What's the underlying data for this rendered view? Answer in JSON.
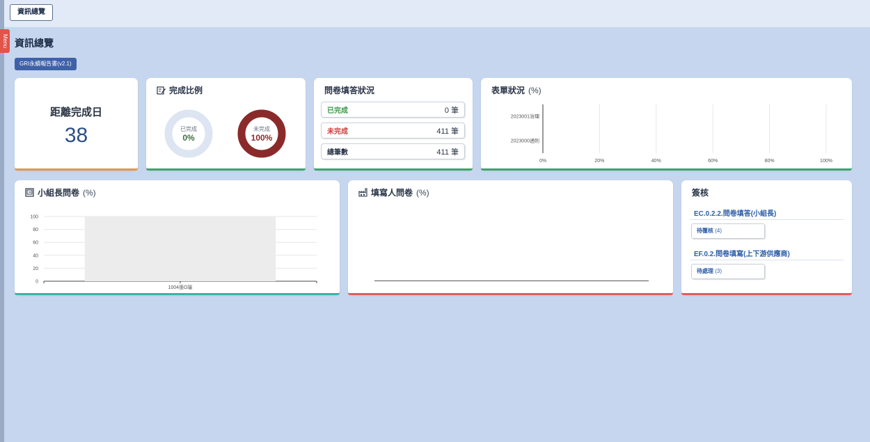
{
  "topbar": {
    "tab_label": "資訊總覽"
  },
  "menu_tab": "Menu",
  "page_title": "資訊總覽",
  "report_badge": "GRI永續報告書(v2.1)",
  "countdown": {
    "label": "距離完成日",
    "value": "38"
  },
  "completion": {
    "title": "完成比例",
    "done": {
      "label": "已完成",
      "value": "0%",
      "ratio": 0,
      "color": "#3e6e3e"
    },
    "undone": {
      "label": "未完成",
      "value": "100%",
      "ratio": 1,
      "color": "#8b2a2a"
    }
  },
  "qstatus": {
    "title": "問卷填答狀況",
    "rows": [
      {
        "label": "已完成",
        "value": "0 筆",
        "color": "#3a9a4a"
      },
      {
        "label": "未完成",
        "value": "411 筆",
        "color": "#d23b3b"
      },
      {
        "label": "總筆數",
        "value": "411 筆",
        "color": "#2a3447"
      }
    ]
  },
  "form_status": {
    "title": "表單狀況",
    "unit": "(%)",
    "chart_data": {
      "type": "bar",
      "orientation": "horizontal",
      "categories": [
        "2023001治理",
        "2023000通則"
      ],
      "values": [
        0,
        0
      ],
      "xlim": [
        0,
        100
      ],
      "xticks": [
        "0%",
        "20%",
        "40%",
        "60%",
        "80%",
        "100%"
      ],
      "grid": true
    }
  },
  "leader_q": {
    "title": "小組長問卷",
    "unit": "(%)",
    "chart_data": {
      "type": "bar",
      "categories": [
        "1004張O瑜"
      ],
      "values": [
        0
      ],
      "ylim": [
        0,
        100
      ],
      "yticks": [
        "0",
        "20",
        "40",
        "60",
        "80",
        "100"
      ],
      "grid": true
    }
  },
  "filler_q": {
    "title": "填寫人問卷",
    "unit": "(%)"
  },
  "signoff": {
    "title": "簽核",
    "items": [
      {
        "link": "EC.0.2.2.問卷填答(小組長)",
        "button": "待覆核",
        "count": "(4)"
      },
      {
        "link": "EF.0.2.問卷填寫(上下游供應商)",
        "button": "待處理",
        "count": "(3)"
      }
    ]
  },
  "colors": {
    "accent": "#3f62a6",
    "background": "#c6d6ee"
  }
}
